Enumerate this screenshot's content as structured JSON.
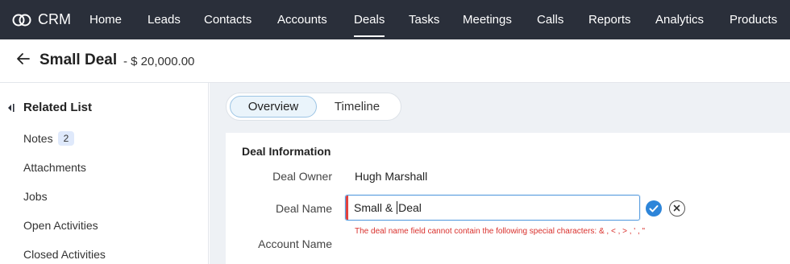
{
  "brand": {
    "label": "CRM",
    "icon": "crm-logo-icon"
  },
  "nav": [
    {
      "label": "Home"
    },
    {
      "label": "Leads"
    },
    {
      "label": "Contacts"
    },
    {
      "label": "Accounts"
    },
    {
      "label": "Deals",
      "active": true
    },
    {
      "label": "Tasks"
    },
    {
      "label": "Meetings"
    },
    {
      "label": "Calls"
    },
    {
      "label": "Reports"
    },
    {
      "label": "Analytics"
    },
    {
      "label": "Products"
    }
  ],
  "record": {
    "title": "Small Deal",
    "amount": "- $ 20,000.00"
  },
  "related_list": {
    "title": "Related List",
    "items": [
      {
        "label": "Notes",
        "count": "2"
      },
      {
        "label": "Attachments"
      },
      {
        "label": "Jobs"
      },
      {
        "label": "Open Activities"
      },
      {
        "label": "Closed Activities"
      }
    ]
  },
  "tabs": [
    {
      "label": "Overview",
      "active": true
    },
    {
      "label": "Timeline"
    }
  ],
  "deal_info": {
    "section_title": "Deal Information",
    "owner_label": "Deal Owner",
    "owner_value": "Hugh Marshall",
    "name_label": "Deal Name",
    "name_before_caret": "Small & ",
    "name_after_caret": "Deal",
    "account_label": "Account Name",
    "error_message": "The deal name field cannot contain the following special characters: & , < , > , ' , \""
  },
  "colors": {
    "nav_bg": "#2a2f3a",
    "accent": "#2d85d9",
    "error": "#d9302c"
  }
}
